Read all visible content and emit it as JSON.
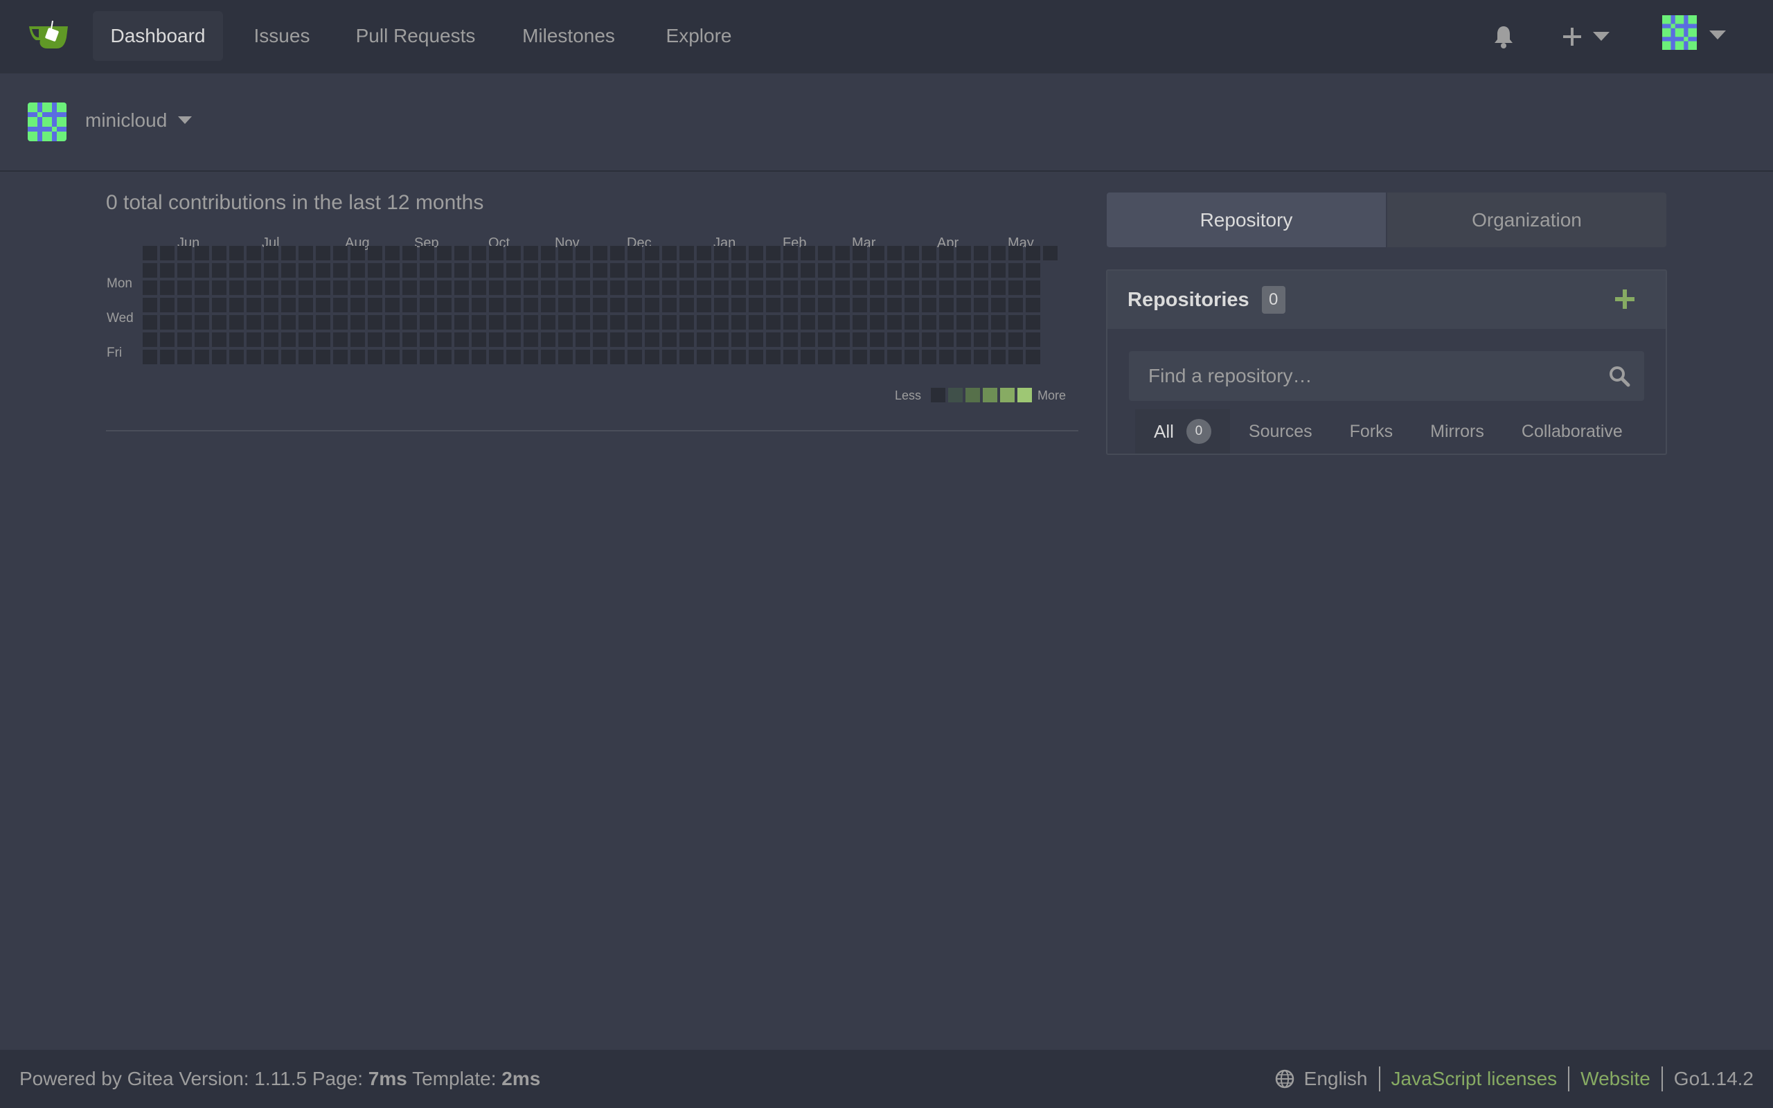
{
  "navbar": {
    "items": [
      {
        "label": "Dashboard",
        "active": true
      },
      {
        "label": "Issues"
      },
      {
        "label": "Pull Requests"
      },
      {
        "label": "Milestones"
      },
      {
        "label": "Explore"
      }
    ],
    "icons": [
      "bell-icon",
      "plus-icon",
      "chevron-down-icon",
      "avatar",
      "chevron-down-icon"
    ]
  },
  "user": {
    "name": "minicloud"
  },
  "heatmap": {
    "title": "0 total contributions in the last 12 months",
    "months": [
      "Jun",
      "Jul",
      "Aug",
      "Sep",
      "Oct",
      "Nov",
      "Dec",
      "Jan",
      "Feb",
      "Mar",
      "Apr",
      "May"
    ],
    "days": [
      "Mon",
      "Wed",
      "Fri"
    ],
    "legend_less": "Less",
    "legend_more": "More",
    "empty_color": "#2a2d36",
    "scale_colors": [
      "#2a2d36",
      "#40504a",
      "#56704a",
      "#6e8f55",
      "#87ab63",
      "#9ec774"
    ]
  },
  "panel": {
    "tabs": [
      {
        "label": "Repository",
        "active": true
      },
      {
        "label": "Organization"
      }
    ],
    "repos": {
      "title": "Repositories",
      "count": "0",
      "search_placeholder": "Find a repository…",
      "filters": [
        {
          "label": "All",
          "count": "0",
          "active": true
        },
        {
          "label": "Sources"
        },
        {
          "label": "Forks"
        },
        {
          "label": "Mirrors"
        },
        {
          "label": "Collaborative"
        }
      ]
    }
  },
  "footer": {
    "powered": "Powered by Gitea Version: 1.11.5 Page: ",
    "page_time": "7ms",
    "template_label": " Template: ",
    "template_time": "2ms",
    "language": "English",
    "js_licenses": "JavaScript licenses",
    "website": "Website",
    "go_version": "Go1.14.2"
  },
  "colors": {
    "accent": "#87ab63",
    "background": "#383c4a",
    "navbar": "#2e323e"
  }
}
